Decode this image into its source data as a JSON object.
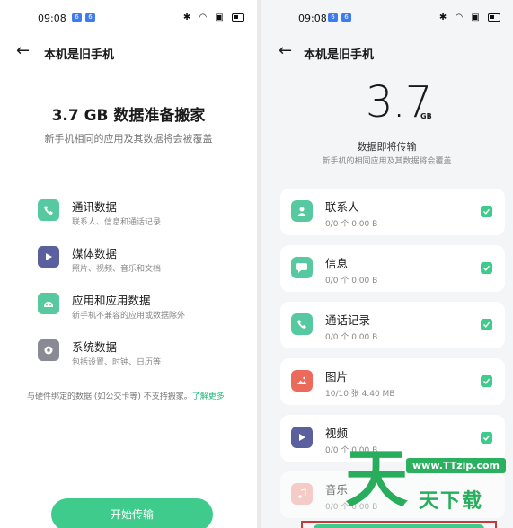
{
  "left": {
    "status": {
      "time": "09:08"
    },
    "header": {
      "title": "本机是旧手机"
    },
    "size_title": "3.7 GB 数据准备搬家",
    "subtitle": "新手机相同的应用及其数据将会被覆盖",
    "categories": [
      {
        "name": "通讯数据",
        "desc": "联系人、信息和通话记录",
        "icon": "phone-icon",
        "color": "#57c9a0"
      },
      {
        "name": "媒体数据",
        "desc": "照片、视频、音乐和文档",
        "icon": "play-icon",
        "color": "#5a5f9e"
      },
      {
        "name": "应用和应用数据",
        "desc": "新手机不兼容的应用或数据除外",
        "icon": "android-icon",
        "color": "#57c9a0"
      },
      {
        "name": "系统数据",
        "desc": "包括设置、时钟、日历等",
        "icon": "gear-icon",
        "color": "#8a8a94"
      }
    ],
    "note": "与硬件绑定的数据 (如公交卡等) 不支持搬家。",
    "note_link": "了解更多",
    "start_button": "开始传输"
  },
  "right": {
    "status": {
      "time": "09:08"
    },
    "header": {
      "title": "本机是旧手机"
    },
    "size_value": "3.7",
    "size_unit": "GB",
    "transfer_title": "数据即将传输",
    "transfer_sub": "新手机的相同应用及其数据将会覆盖",
    "items": [
      {
        "name": "联系人",
        "meta": "0/0 个   0.00 B",
        "icon": "contact-icon",
        "color": "#57c9a0"
      },
      {
        "name": "信息",
        "meta": "0/0 个   0.00 B",
        "icon": "message-icon",
        "color": "#57c9a0"
      },
      {
        "name": "通话记录",
        "meta": "0/0 个   0.00 B",
        "icon": "phone-icon",
        "color": "#57c9a0"
      },
      {
        "name": "图片",
        "meta": "10/10 张   4.40 MB",
        "icon": "image-icon",
        "color": "#ec6a5c"
      },
      {
        "name": "视频",
        "meta": "0/0 个   0.00 B",
        "icon": "play-icon",
        "color": "#5a5f9e"
      },
      {
        "name": "音乐",
        "meta": "0/0 个   0.00 B",
        "icon": "music-icon",
        "color": "#f4b0a8"
      }
    ]
  },
  "watermark": {
    "url": "www.TTzip.com",
    "big": "天",
    "sub": "天下载"
  },
  "colors": {
    "accent": "#3ecb8c",
    "link": "#26b77a"
  }
}
